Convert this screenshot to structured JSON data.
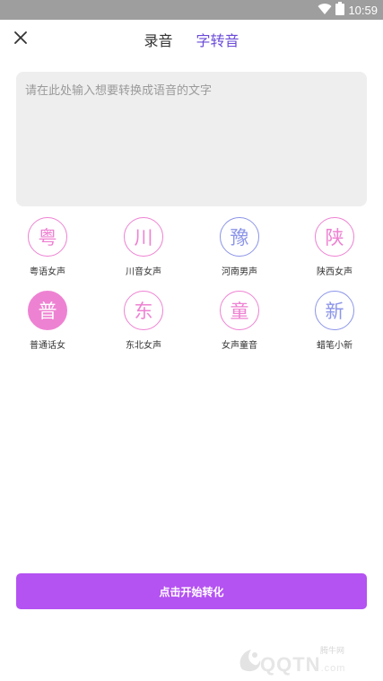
{
  "status_bar": {
    "time": "10:59",
    "icons": [
      "wifi-icon",
      "battery-icon"
    ],
    "background": "#9e9e9e"
  },
  "topbar": {
    "close_icon": "close-icon",
    "tabs": [
      {
        "label": "录音",
        "active": false
      },
      {
        "label": "字转音",
        "active": true
      }
    ],
    "active_color": "#6a4bd8"
  },
  "input": {
    "placeholder": "请在此处输入想要转换成语音的文字",
    "value": ""
  },
  "voices": [
    {
      "char": "粤",
      "label": "粤语女声",
      "color": "pink",
      "selected": false
    },
    {
      "char": "川",
      "label": "川音女声",
      "color": "pink",
      "selected": false
    },
    {
      "char": "豫",
      "label": "河南男声",
      "color": "blue",
      "selected": false
    },
    {
      "char": "陕",
      "label": "陕西女声",
      "color": "pink",
      "selected": false
    },
    {
      "char": "普",
      "label": "普通话女",
      "color": "pink",
      "selected": true
    },
    {
      "char": "东",
      "label": "东北女声",
      "color": "pink",
      "selected": false
    },
    {
      "char": "童",
      "label": "女声童音",
      "color": "pink",
      "selected": false
    },
    {
      "char": "新",
      "label": "蜡笔小新",
      "color": "blue",
      "selected": false
    }
  ],
  "convert_button": {
    "label": "点击开始转化",
    "color": "#b452f2"
  },
  "watermark": {
    "brand": "QQTN",
    "sub": "腾牛网",
    "suffix": ".com"
  }
}
